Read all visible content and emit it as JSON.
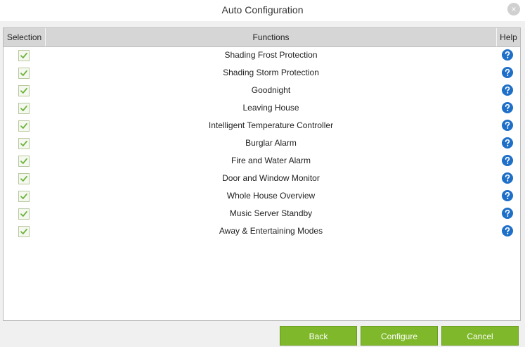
{
  "window": {
    "title": "Auto Configuration",
    "close_glyph": "×"
  },
  "table": {
    "headers": {
      "selection": "Selection",
      "functions": "Functions",
      "help": "Help"
    },
    "rows": [
      {
        "label": "Shading Frost Protection",
        "checked": true
      },
      {
        "label": "Shading Storm Protection",
        "checked": true
      },
      {
        "label": "Goodnight",
        "checked": true
      },
      {
        "label": "Leaving House",
        "checked": true
      },
      {
        "label": "Intelligent Temperature Controller",
        "checked": true
      },
      {
        "label": "Burglar Alarm",
        "checked": true
      },
      {
        "label": "Fire and Water Alarm",
        "checked": true
      },
      {
        "label": "Door and Window Monitor",
        "checked": true
      },
      {
        "label": "Whole House Overview",
        "checked": true
      },
      {
        "label": "Music Server Standby",
        "checked": true
      },
      {
        "label": "Away & Entertaining Modes",
        "checked": true
      }
    ]
  },
  "buttons": {
    "back": "Back",
    "configure": "Configure",
    "cancel": "Cancel"
  },
  "colors": {
    "accent": "#7fb82a",
    "check": "#6cb33e",
    "help": "#1e6fc8",
    "header": "#d6d6d6"
  },
  "icons": {
    "check": "check-icon",
    "help": "help-icon",
    "close": "close-icon"
  }
}
